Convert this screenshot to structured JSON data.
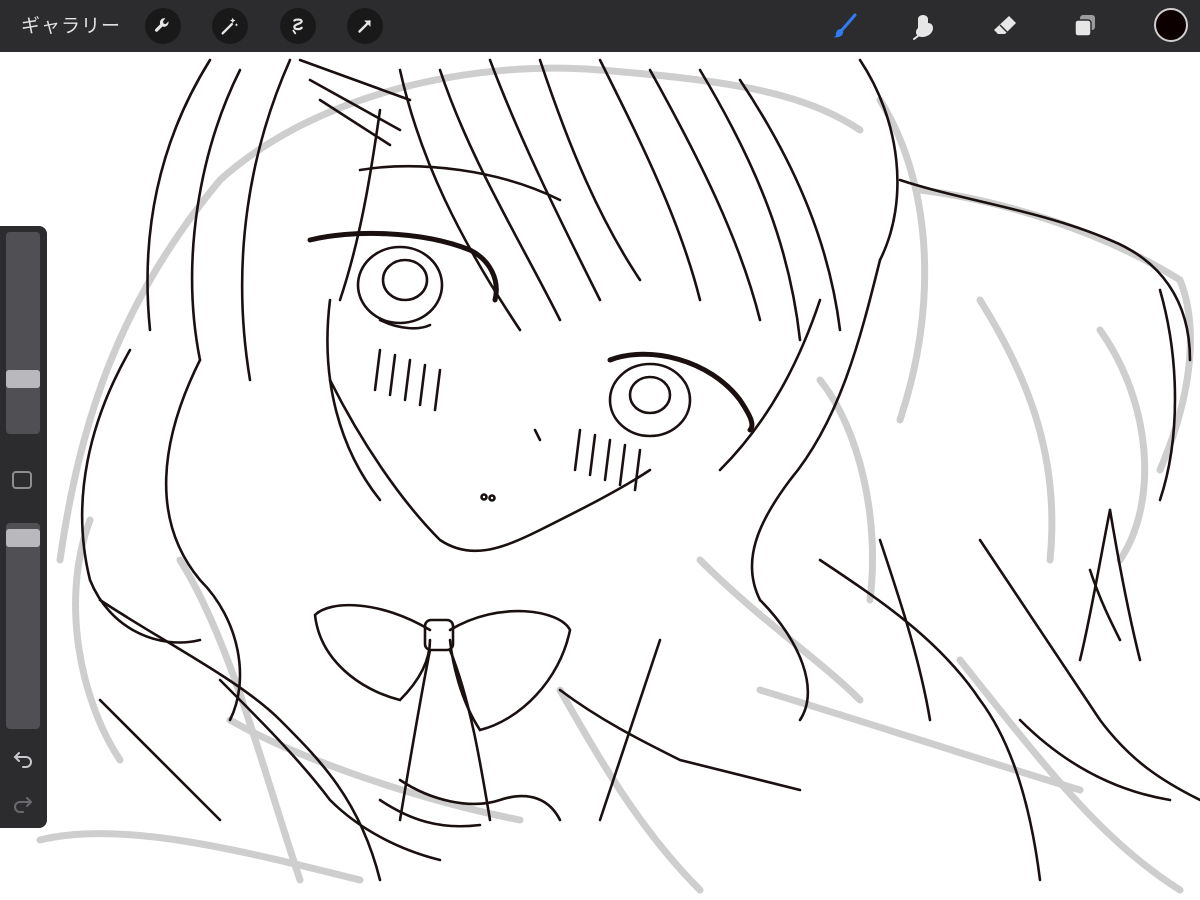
{
  "toolbar": {
    "gallery_label": "ギャラリー",
    "left_tools": [
      "wrench-icon",
      "magic-wand-icon",
      "selection-icon",
      "move-arrow-icon"
    ],
    "right_tools": [
      "brush-icon",
      "smudge-icon",
      "eraser-icon",
      "layers-icon"
    ],
    "active_tool": "brush-icon",
    "accent_color": "#2f7cf6",
    "current_color": "#0d0000"
  },
  "sidebar": {
    "brush_size_level": 0.38,
    "opacity_level": 0.95,
    "icons": [
      "modify-square-icon",
      "undo-icon",
      "redo-icon"
    ]
  },
  "canvas": {
    "content": "line-art-sketch"
  }
}
